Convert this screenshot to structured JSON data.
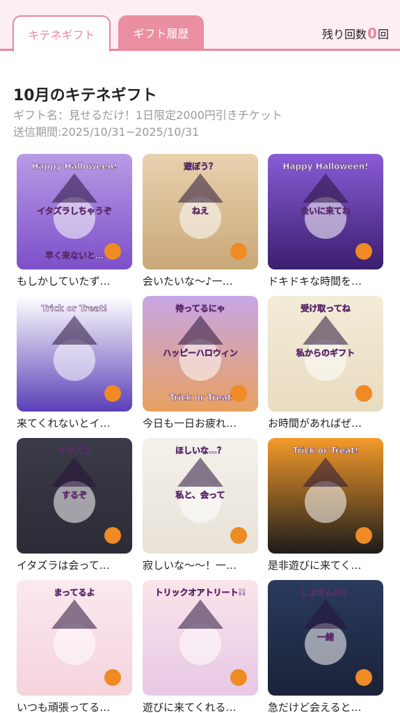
{
  "tabs": {
    "active_label": "キテネギフト",
    "history_label": "ギフト履歴"
  },
  "remaining": {
    "prefix": "残り回数",
    "count": "0",
    "suffix": "回"
  },
  "heading": "10月のキテネギフト",
  "gift_name": "ギフト名：見せるだけ！1日限定2000円引きチケット",
  "period": "送信期間:2025/10/31~2025/10/31",
  "stickers": [
    {
      "caption": "もしかしていたず…",
      "art": [
        "Happy Halloween!",
        "イタズラしちゃうぞ",
        "早く来ないと…"
      ],
      "colors": [
        "#b89be6",
        "#7d4fc9"
      ]
    },
    {
      "caption": "会いたいな～♪一…",
      "art": [
        "遊ぼう？",
        "ねえ"
      ],
      "colors": [
        "#e8d2ae",
        "#c9a878"
      ]
    },
    {
      "caption": "ドキドキな時間を…",
      "art": [
        "Happy Halloween!",
        "会いに来てね"
      ],
      "colors": [
        "#8a5cd6",
        "#3a1e6e"
      ]
    },
    {
      "caption": "来てくれないとイ…",
      "art": [
        "Trick or Treat!"
      ],
      "colors": [
        "#ffffff",
        "#5b3fb8"
      ]
    },
    {
      "caption": "今日も一日お疲れ…",
      "art": [
        "待ってるにゃ",
        "ハッピーハロウィン",
        "Trick or Treat"
      ],
      "colors": [
        "#c7a6e6",
        "#e8a060"
      ]
    },
    {
      "caption": "お時間があればぜ…",
      "art": [
        "受け取ってね",
        "私からのギフト"
      ],
      "colors": [
        "#f3ecd8",
        "#e8dcc0"
      ]
    },
    {
      "caption": "イタズラは会って…",
      "art": [
        "イタズラ",
        "するぞ"
      ],
      "colors": [
        "#3a3a48",
        "#2c2c38"
      ]
    },
    {
      "caption": "寂しいな～～！一…",
      "art": [
        "ほしいな…？",
        "私と、会って"
      ],
      "colors": [
        "#f4f1ec",
        "#e8e2d8"
      ]
    },
    {
      "caption": "是非遊びに来てく…",
      "art": [
        "Trick or Treat!"
      ],
      "colors": [
        "#f49a2a",
        "#1b1b1b"
      ]
    },
    {
      "caption": "いつも頑張ってる…",
      "art": [
        "まってるよ"
      ],
      "colors": [
        "#fbe9ee",
        "#f5d3dc"
      ]
    },
    {
      "caption": "遊びに来てくれる…",
      "art": [
        "トリックオアトリート!!"
      ],
      "colors": [
        "#fbe4ea",
        "#e7c8e6"
      ]
    },
    {
      "caption": "急だけど会えると…",
      "art": [
        "しませんか？",
        "一緒"
      ],
      "colors": [
        "#2a3b5e",
        "#1a2238"
      ]
    }
  ]
}
